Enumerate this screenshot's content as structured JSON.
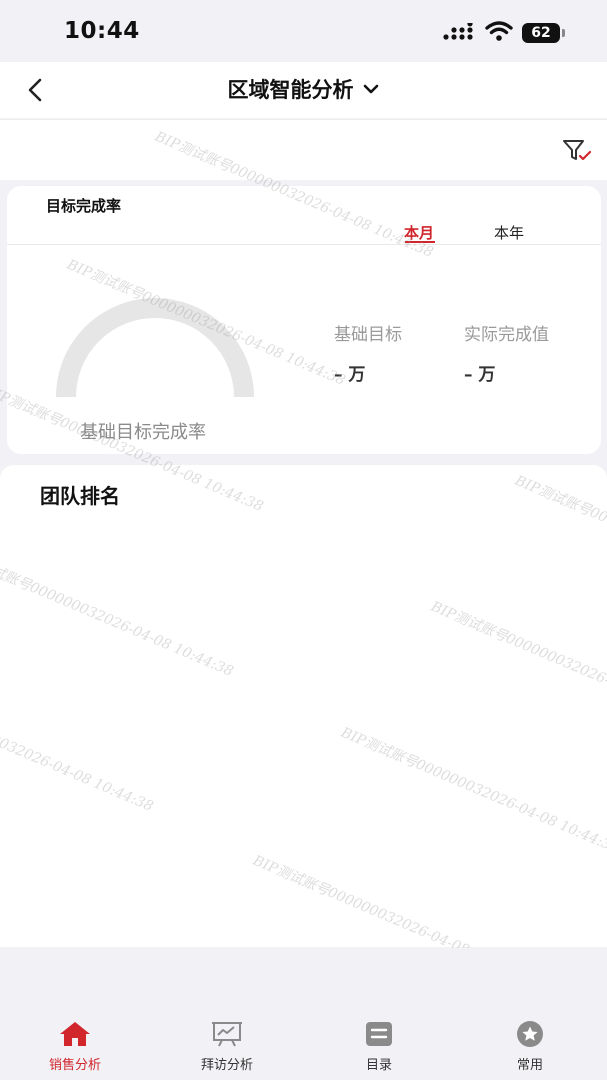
{
  "status_bar": {
    "time": "10:44",
    "battery": "62"
  },
  "nav": {
    "title": "区域智能分析"
  },
  "kpi_card": {
    "title": "目标完成率",
    "tabs": [
      "本月",
      "本年"
    ],
    "active_tab": "本月",
    "gauge_label": "基础目标完成率",
    "base_target_label": "基础目标",
    "base_target_value": "– 万",
    "actual_label": "实际完成值",
    "actual_value": "– 万"
  },
  "team_card": {
    "title": "团队排名"
  },
  "watermark_text": "BIP测试账号000000032026-04-08 10:44:38",
  "tabbar": {
    "items": [
      {
        "label": "销售分析",
        "icon": "home-icon",
        "active": true
      },
      {
        "label": "拜访分析",
        "icon": "presentation-chart-icon",
        "active": false
      },
      {
        "label": "目录",
        "icon": "catalog-icon",
        "active": false
      },
      {
        "label": "常用",
        "icon": "star-icon",
        "active": false
      }
    ]
  },
  "colors": {
    "accent": "#d0262c",
    "background": "#f2f2f6",
    "gauge_track": "#e6e6e6"
  }
}
